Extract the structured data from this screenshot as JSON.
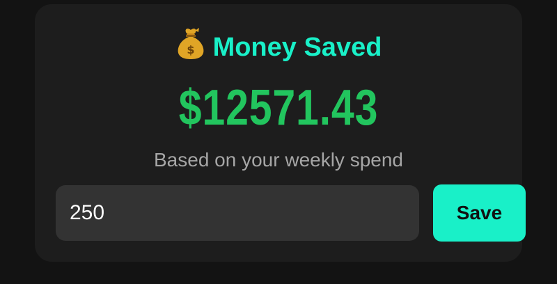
{
  "card": {
    "icon": "money-bag-icon",
    "title": "Money Saved",
    "amount": "$12571.43",
    "subtitle": "Based on your weekly spend"
  },
  "weekly_spend_input": {
    "value": "250",
    "placeholder": ""
  },
  "save_button": {
    "label": "Save"
  },
  "colors": {
    "page_background": "#131313",
    "card_background": "#1d1d1d",
    "accent": "#19f0c8",
    "amount": "#22c55e",
    "subtitle": "#a6a6a6",
    "input_background": "#333333"
  }
}
